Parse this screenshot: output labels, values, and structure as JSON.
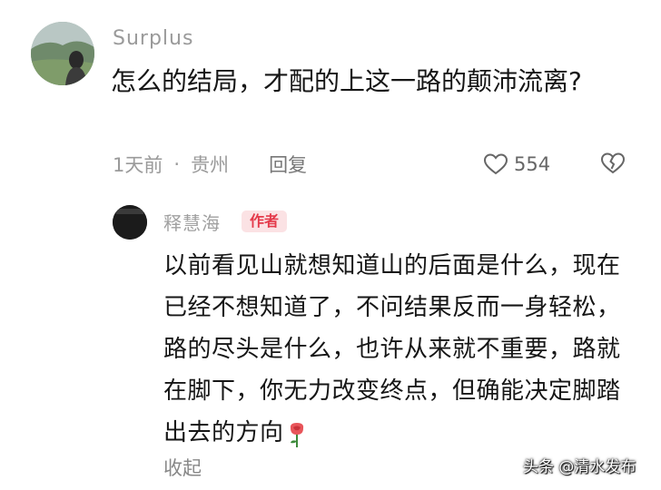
{
  "comment": {
    "username": "Surplus",
    "text": "怎么的结局，才配的上这一路的颠沛流离?",
    "time": "1天前",
    "location": "贵州",
    "separator": "·",
    "reply_label": "回复",
    "like_count": "554",
    "icons": [
      "heart-icon",
      "broken-heart-icon"
    ]
  },
  "reply": {
    "username": "释慧海",
    "badge": "作者",
    "text": "以前看见山就想知道山的后面是什么，现在已经不想知道了，不问结果反而一身轻松，路的尽头是什么，也许从来就不重要，路就在脚下，你无力改变终点，但确能决定脚踏出去的方向",
    "emoji": "rose-icon",
    "collapse_label": "收起"
  },
  "watermark": "头条 @清水发布",
  "colors": {
    "badge_bg": "#fbe2e4",
    "badge_text": "#e4394a",
    "meta_text": "#9a9a9a"
  }
}
